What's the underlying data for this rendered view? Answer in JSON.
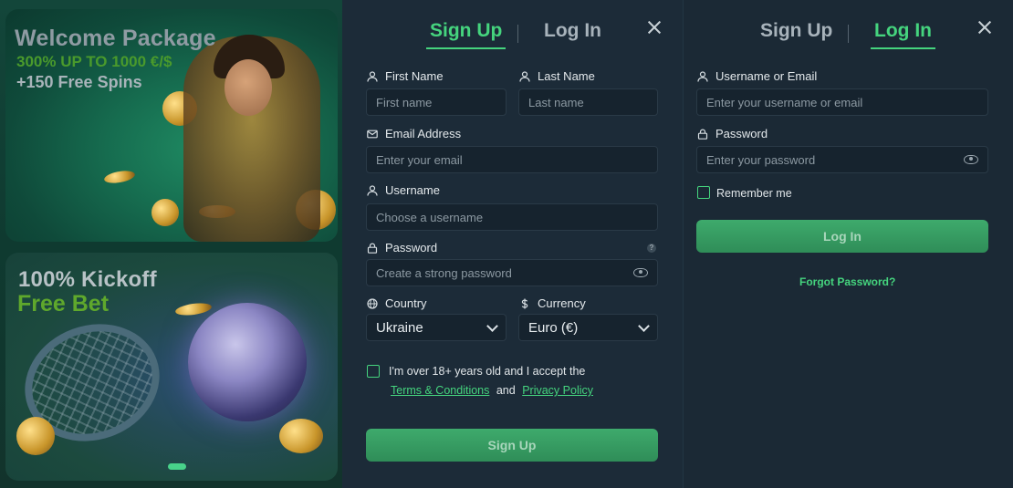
{
  "promo": {
    "welcome_title": "Welcome Package",
    "welcome_line1": "300% UP TO 1000 €/$",
    "welcome_line2": "+150 Free Spins",
    "kickoff_title": "100% Kickoff",
    "kickoff_sub": "Free Bet"
  },
  "signup": {
    "tab_signup": "Sign Up",
    "tab_login": "Log In",
    "first_name_label": "First Name",
    "first_name_placeholder": "First name",
    "last_name_label": "Last Name",
    "last_name_placeholder": "Last name",
    "email_label": "Email Address",
    "email_placeholder": "Enter your email",
    "username_label": "Username",
    "username_placeholder": "Choose a username",
    "password_label": "Password",
    "password_placeholder": "Create a strong password",
    "password_help": "?",
    "country_label": "Country",
    "country_value": "Ukraine",
    "currency_label": "Currency",
    "currency_value": "Euro (€)",
    "terms_prefix": "I'm over 18+ years old and I accept the",
    "terms_link": "Terms & Conditions",
    "terms_and": "and",
    "privacy_link": "Privacy Policy",
    "submit": "Sign Up"
  },
  "login": {
    "tab_signup": "Sign Up",
    "tab_login": "Log In",
    "user_label": "Username or Email",
    "user_placeholder": "Enter your username or email",
    "password_label": "Password",
    "password_placeholder": "Enter your password",
    "remember": "Remember me",
    "submit": "Log In",
    "forgot": "Forgot Password?"
  },
  "colors": {
    "accent": "#45d47e",
    "panel": "#1c2b38",
    "input": "#16232e"
  }
}
